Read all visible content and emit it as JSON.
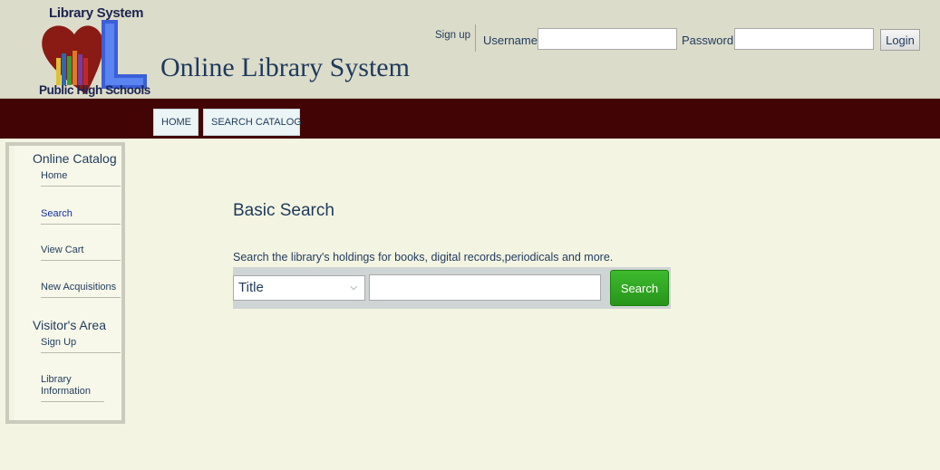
{
  "logo": {
    "top_text": "Library System",
    "bottom_text": "Public High Schools"
  },
  "site_title": "Online Library System",
  "auth": {
    "signup_label": "Sign up",
    "username_label": "Username",
    "username_value": "",
    "password_label": "Password",
    "password_value": "",
    "login_label": "Login"
  },
  "nav": {
    "home_label": "HOME",
    "search_catalog_label": "SEARCH CATALOG"
  },
  "sidebar": {
    "catalog_title": "Online Catalog",
    "catalog_items": [
      "Home",
      "Search",
      "View Cart",
      "New Acquisitions"
    ],
    "visitor_title": "Visitor's Area",
    "visitor_items": [
      "Sign Up",
      "Library Information"
    ]
  },
  "content": {
    "title": "Basic Search",
    "description": "Search the library's holdings for books, digital records,periodicals and more.",
    "search_field_selected": "Title",
    "search_query": "",
    "search_button": "Search"
  },
  "colors": {
    "header_bg": "#dcdcca",
    "navbar_bg": "#420405",
    "page_bg": "#f4f4e2",
    "search_button_bg": "#2fa822",
    "text": "#1e3a5c"
  }
}
